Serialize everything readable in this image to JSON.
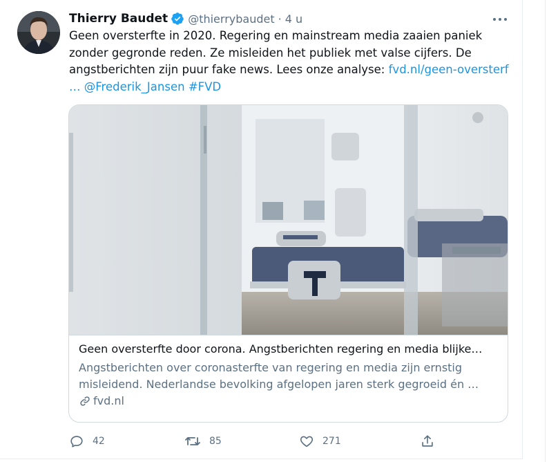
{
  "tweet": {
    "author_name": "Thierry Baudet",
    "author_handle": "@thierrybaudet",
    "separator": "·",
    "time": "4 u",
    "text_line1": "Geen oversterfte in 2020. Regering en mainstream media zaaien paniek",
    "text_line2": "zonder gegronde reden. Ze misleiden het publiek met valse cijfers. De",
    "text_line3_plain": "angstberichten zijn puur fake news. Lees onze analyse: ",
    "text_line3_link": "fvd.nl/geen-oversterf",
    "text_line4_ellipsis": "…",
    "mention": "@Frederik_Jansen",
    "hashtag": "#FVD"
  },
  "card": {
    "title": "Geen oversterfte door corona. Angstberichten regering en media blijke…",
    "desc_line1": "Angstberichten over coronasterfte van regering en media zijn ernstig",
    "desc_line2": "misleidend. Nederlandse bevolking afgelopen jaren sterk gegroeid én …",
    "domain": "fvd.nl"
  },
  "actions": {
    "reply_count": "42",
    "retweet_count": "85",
    "like_count": "271"
  },
  "colors": {
    "link": "#1b95e0",
    "verified": "#1da1f2",
    "secondary_text": "#5b7083"
  },
  "icons": [
    "verified-badge-icon",
    "more-icon",
    "link-icon",
    "reply-icon",
    "retweet-icon",
    "like-icon",
    "share-icon"
  ]
}
